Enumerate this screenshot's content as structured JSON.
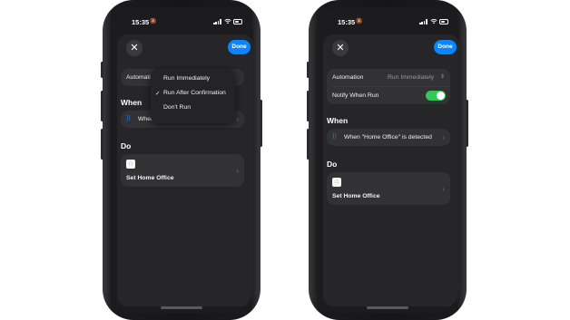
{
  "status": {
    "time": "15:35"
  },
  "left": {
    "close_glyph": "✕",
    "done_label": "Done",
    "automation_label": "Automation",
    "when_title": "When",
    "trigger_text": "When \"Home Office\" is detected",
    "do_title": "Do",
    "action_label": "Set Home Office",
    "menu": {
      "items": [
        "Run Immediately",
        "Run After Confirmation",
        "Don't Run"
      ],
      "selected_index": 1,
      "check_glyph": "✓"
    }
  },
  "right": {
    "close_glyph": "✕",
    "done_label": "Done",
    "automation_label": "Automation",
    "automation_value": "Run Immediately",
    "notify_label": "Notify When Run",
    "notify_on": true,
    "when_title": "When",
    "trigger_text": "When \"Home Office\" is detected",
    "do_title": "Do",
    "action_label": "Set Home Office"
  },
  "icons": {
    "close": "close-icon",
    "trigger": "nfc-signal-icon",
    "chevron": "chevron-right-icon",
    "home": "home-icon",
    "check": "checkmark-icon",
    "updown": "chevron-up-down-icon"
  },
  "colors": {
    "accent": "#0a84ff",
    "toggle_on": "#34c759",
    "home_icon": "#ff9f0a"
  }
}
